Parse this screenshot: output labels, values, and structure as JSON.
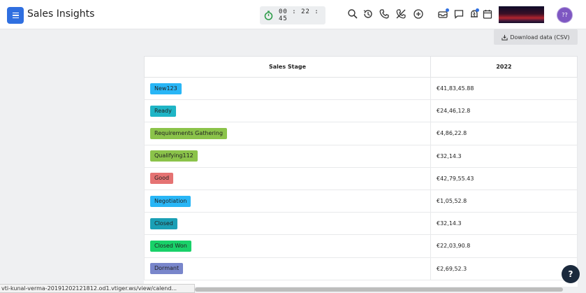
{
  "header": {
    "app_title": "Sales Insights",
    "menu_icon": "hamburger-menu-icon",
    "timer": "00 : 22 : 45",
    "avatar_text": "??",
    "icons": [
      "search-icon",
      "history-icon",
      "phone-icon",
      "mute-icon",
      "add-icon",
      "inbox-icon",
      "chat-icon",
      "bell-icon",
      "calendar-icon"
    ]
  },
  "toolbar": {
    "download_label": "Download data (CSV)"
  },
  "table": {
    "headers": [
      "Sales Stage",
      "2022"
    ],
    "rows": [
      {
        "stage": "New123",
        "color": "#29b6f6",
        "value": "€41,83,45.88"
      },
      {
        "stage": "Ready",
        "color": "#1fb5c6",
        "value": "€24,46,12.8"
      },
      {
        "stage": "Requirements Gathering",
        "color": "#8bc34a",
        "value": "€4,86,22.8"
      },
      {
        "stage": "Qualifying112",
        "color": "#8bc34a",
        "value": "€32,14.3"
      },
      {
        "stage": "Good",
        "color": "#e57373",
        "value": "€42,79,55.43"
      },
      {
        "stage": "Negotiation",
        "color": "#29b6f6",
        "value": "€1,05,52.8"
      },
      {
        "stage": "Closed",
        "color": "#1a9fb5",
        "value": "€32,14.3"
      },
      {
        "stage": "Closed Won",
        "color": "#19d169",
        "value": "€22,03,90.8"
      },
      {
        "stage": "Dormant",
        "color": "#7986cb",
        "value": "€2,69,52.3"
      }
    ]
  },
  "status_bar": {
    "url": "vti-kunal-verma-20191202121812.od1.vtiger.ws/view/calend..."
  },
  "help_label": "?"
}
